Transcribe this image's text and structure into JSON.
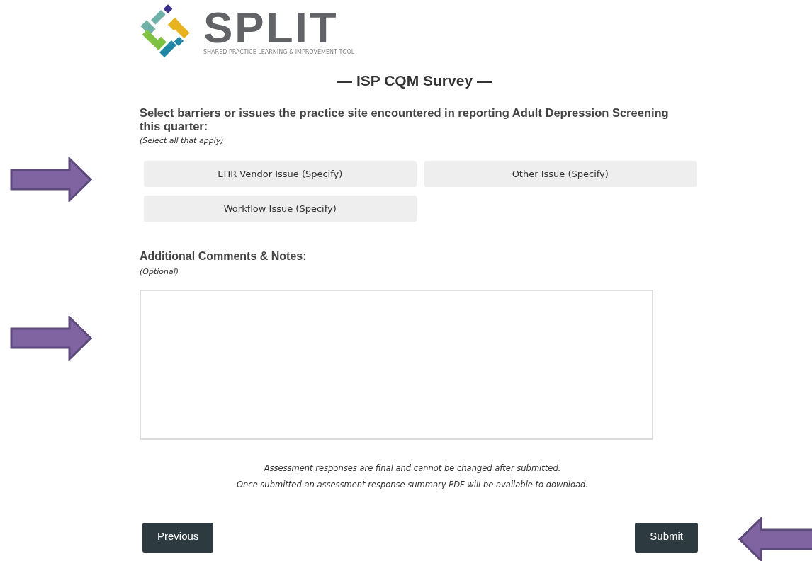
{
  "logo": {
    "wordmark": "SPLIT",
    "tagline": "SHARED PRACTICE LEARNING & IMPROVEMENT TOOL"
  },
  "survey_title": "— ISP CQM Survey —",
  "question": {
    "prompt_before": "Select barriers or issues the practice site encountered in reporting ",
    "measure_link": "Adult Depression Screening",
    "prompt_after": " this quarter:",
    "hint": "(Select all that apply)"
  },
  "options": [
    {
      "label": "EHR Vendor Issue (Specify)",
      "selected": false
    },
    {
      "label": "Other Issue (Specify)",
      "selected": false
    },
    {
      "label": "Workflow Issue (Specify)",
      "selected": false
    }
  ],
  "comments": {
    "label": "Additional Comments & Notes:",
    "hint": "(Optional)"
  },
  "notices": [
    "Assessment responses are final and cannot be changed after submitted.",
    "Once submitted an assessment response summary PDF will be available to download."
  ],
  "buttons": {
    "previous": "Previous",
    "submit": "Submit"
  }
}
